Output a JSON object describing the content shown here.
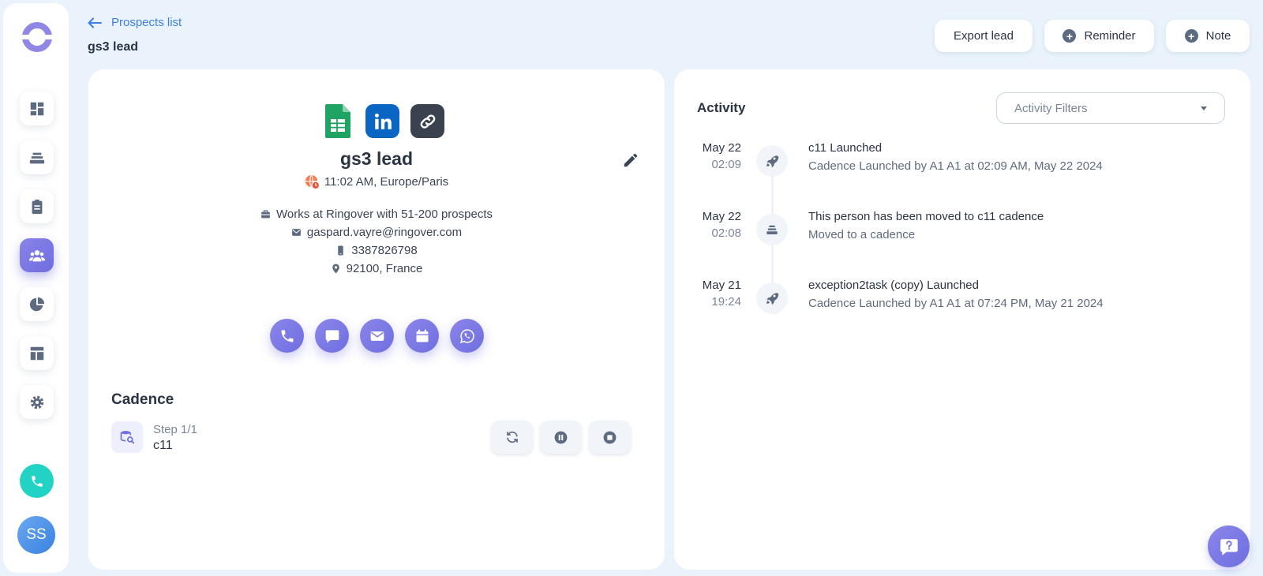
{
  "header": {
    "back_label": "Prospects list",
    "lead_title": "gs3 lead",
    "export_label": "Export lead",
    "reminder_label": "Reminder",
    "note_label": "Note"
  },
  "sidebar": {
    "items": [
      {
        "icon": "dashboard-icon"
      },
      {
        "icon": "stack-icon"
      },
      {
        "icon": "clipboard-icon"
      },
      {
        "icon": "people-icon",
        "active": true
      },
      {
        "icon": "pie-chart-icon"
      },
      {
        "icon": "layout-icon"
      },
      {
        "icon": "gear-icon"
      }
    ],
    "avatar_initials": "SS"
  },
  "lead": {
    "name": "gs3 lead",
    "time_zone": "11:02 AM, Europe/Paris",
    "work": "Works at Ringover with 51-200 prospects",
    "email": "gaspard.vayre@ringover.com",
    "phone": "3387826798",
    "location": "92100, France",
    "sources": [
      "google-sheets-icon",
      "linkedin-icon",
      "link-icon"
    ]
  },
  "cadence": {
    "title": "Cadence",
    "step": "Step 1/1",
    "name": "c11"
  },
  "activity": {
    "title": "Activity",
    "filter_placeholder": "Activity Filters",
    "items": [
      {
        "date": "May 22",
        "time": "02:09",
        "icon": "rocket-icon",
        "title": "c11 Launched",
        "desc": "Cadence Launched by A1 A1 at 02:09 AM, May 22 2024"
      },
      {
        "date": "May 22",
        "time": "02:08",
        "icon": "stack-icon",
        "title": "This person has been moved to c11 cadence",
        "desc": "Moved to a cadence"
      },
      {
        "date": "May 21",
        "time": "19:24",
        "icon": "rocket-icon",
        "title": "exception2task (copy) Launched",
        "desc": "Cadence Launched by A1 A1 at 07:24 PM, May 21 2024"
      }
    ]
  },
  "colors": {
    "accent": "#7b79e6",
    "link": "#3d7fe6",
    "teal": "#22d3c5",
    "background": "#eaf3fb"
  }
}
